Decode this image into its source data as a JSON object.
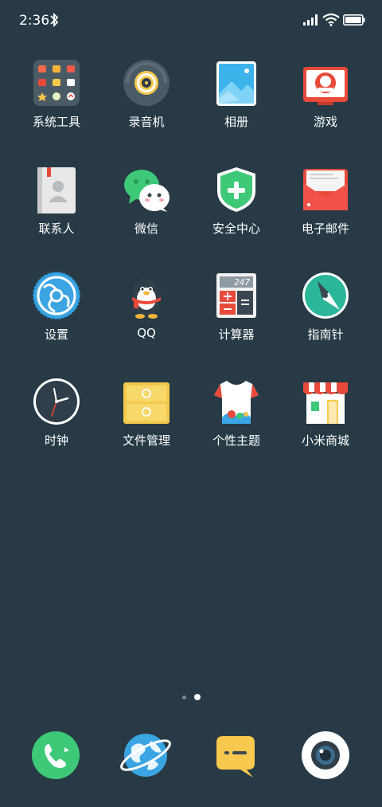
{
  "status_bar": {
    "time": "2:36",
    "icons": [
      "bluetooth-icon",
      "signal-icon",
      "wifi-icon",
      "battery-icon"
    ]
  },
  "apps": [
    {
      "label": "系统工具",
      "icon": "folder-system-tools-icon"
    },
    {
      "label": "录音机",
      "icon": "recorder-icon"
    },
    {
      "label": "相册",
      "icon": "gallery-icon"
    },
    {
      "label": "游戏",
      "icon": "games-icon"
    },
    {
      "label": "联系人",
      "icon": "contacts-icon"
    },
    {
      "label": "微信",
      "icon": "wechat-icon"
    },
    {
      "label": "安全中心",
      "icon": "security-shield-icon"
    },
    {
      "label": "电子邮件",
      "icon": "email-envelope-icon"
    },
    {
      "label": "设置",
      "icon": "settings-gear-icon"
    },
    {
      "label": "QQ",
      "icon": "qq-penguin-icon"
    },
    {
      "label": "计算器",
      "icon": "calculator-icon"
    },
    {
      "label": "指南针",
      "icon": "compass-icon"
    },
    {
      "label": "时钟",
      "icon": "clock-icon"
    },
    {
      "label": "文件管理",
      "icon": "file-manager-icon"
    },
    {
      "label": "个性主题",
      "icon": "themes-icon"
    },
    {
      "label": "小米商城",
      "icon": "mi-store-icon"
    }
  ],
  "calculator_display": "247",
  "page_indicator": {
    "pages": 2,
    "current": 2
  },
  "dock": [
    {
      "icon": "phone-icon"
    },
    {
      "icon": "browser-globe-icon"
    },
    {
      "icon": "messages-icon"
    },
    {
      "icon": "camera-icon"
    }
  ],
  "colors": {
    "background": "#273a45",
    "phone_green": "#3ec978",
    "message_yellow": "#f7c94e",
    "browser_blue": "#3ba5e4"
  }
}
